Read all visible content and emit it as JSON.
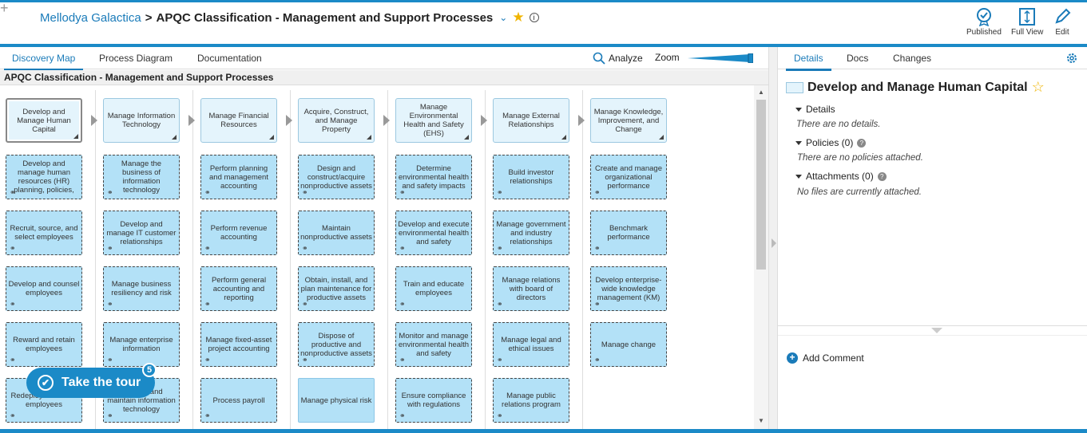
{
  "header": {
    "breadcrumb_link": "Mellodya Galactica",
    "separator": ">",
    "title": "APQC Classification - Management and Support Processes",
    "actions": [
      {
        "label": "Published",
        "icon": "published-check-icon"
      },
      {
        "label": "Full View",
        "icon": "full-view-icon"
      },
      {
        "label": "Edit",
        "icon": "edit-pencil-icon"
      }
    ]
  },
  "left_tabs": [
    "Discovery Map",
    "Process Diagram",
    "Documentation"
  ],
  "toolbar": {
    "analyze": "Analyze",
    "zoom": "Zoom"
  },
  "process_title": "APQC Classification - Management and Support Processes",
  "map": {
    "columns": [
      {
        "header": "Develop and Manage Human Capital",
        "children": [
          "Develop and manage human resources (HR) planning, policies,",
          "Recruit, source, and select employees",
          "Develop and counsel employees",
          "Reward and retain employees",
          "Redeploy and retire employees"
        ]
      },
      {
        "header": "Manage Information Technology",
        "children": [
          "Manage the business of information technology",
          "Develop and manage IT customer relationships",
          "Manage business resiliency and risk",
          "Manage enterprise information",
          "Develop and maintain information technology"
        ]
      },
      {
        "header": "Manage Financial Resources",
        "children": [
          "Perform planning and management accounting",
          "Perform revenue accounting",
          "Perform general accounting and reporting",
          "Manage fixed-asset project accounting",
          "Process payroll"
        ]
      },
      {
        "header": "Acquire, Construct, and Manage Property",
        "children": [
          "Design and construct/acquire nonproductive assets",
          "Maintain nonproductive assets",
          "Obtain, install, and plan maintenance for productive assets",
          "Dispose of productive and nonproductive assets",
          "Manage physical risk"
        ]
      },
      {
        "header": "Manage Environmental Health and Safety (EHS)",
        "children": [
          "Determine environmental health and safety impacts",
          "Develop and execute environmental health and safety",
          "Train and educate employees",
          "Monitor and manage environmental health and safety",
          "Ensure compliance with regulations"
        ]
      },
      {
        "header": "Manage External Relationships",
        "children": [
          "Build investor relationships",
          "Manage government and industry relationships",
          "Manage relations with board of directors",
          "Manage legal and ethical issues",
          "Manage public relations program"
        ]
      },
      {
        "header": "Manage Knowledge, Improvement, and Change",
        "children": [
          "Create and manage organizational performance",
          "Benchmark performance",
          "Develop enterprise-wide knowledge management (KM)",
          "Manage change"
        ]
      }
    ]
  },
  "right_tabs": [
    "Details",
    "Docs",
    "Changes"
  ],
  "details": {
    "title": "Develop and Manage Human Capital",
    "details_label": "Details",
    "details_note": "There are no details.",
    "policies_label": "Policies (0)",
    "policies_note": "There are no policies attached.",
    "attachments_label": "Attachments (0)",
    "attachments_note": "No files are currently attached.",
    "add_comment": "Add Comment"
  },
  "tour": {
    "label": "Take the tour",
    "badge": "5"
  },
  "colors": {
    "accent": "#1b8ac7",
    "header_box": "#e4f4fc",
    "child_box": "#b3e1f7",
    "star": "#f0b400"
  }
}
